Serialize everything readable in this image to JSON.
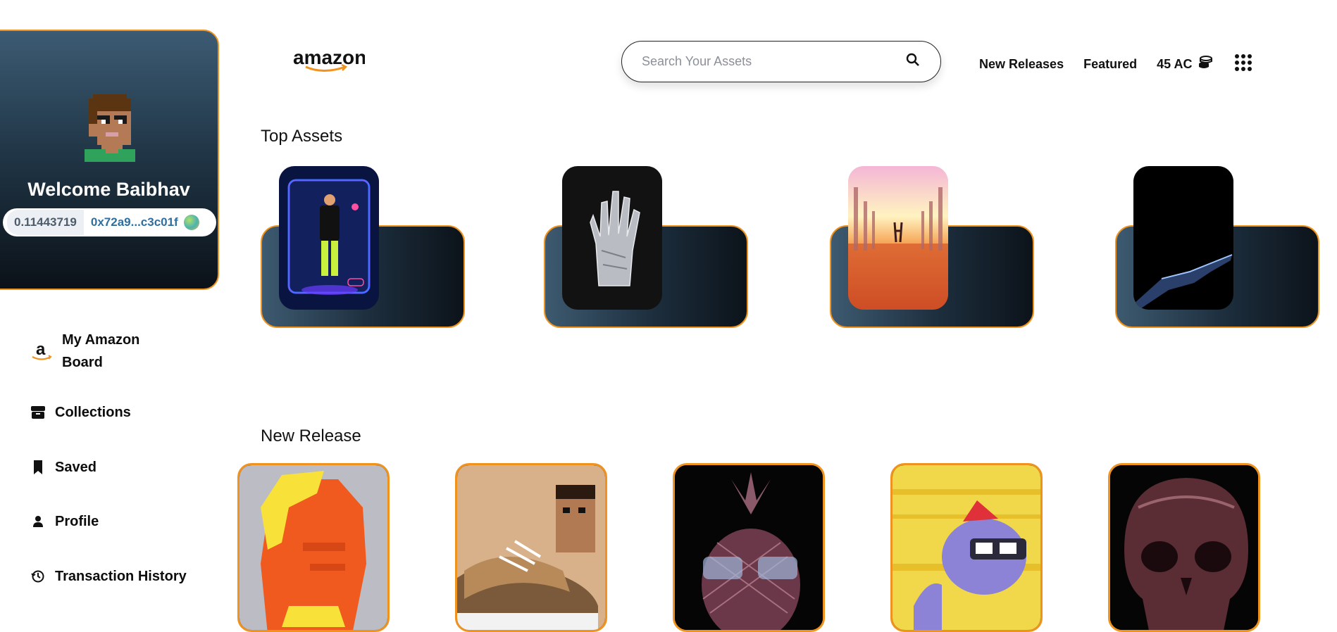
{
  "profile": {
    "welcome": "Welcome Baibhav",
    "balance": "0.11443719",
    "address": "0x72a9...c3c01f"
  },
  "sidebar": {
    "items": [
      {
        "label_line1": "My Amazon",
        "label_line2": "Board",
        "icon": "amazon-a-icon"
      },
      {
        "label": "Collections",
        "icon": "box-icon"
      },
      {
        "label": "Saved",
        "icon": "bookmark-icon"
      },
      {
        "label": "Profile",
        "icon": "user-icon"
      },
      {
        "label": "Transaction History",
        "icon": "history-icon"
      }
    ]
  },
  "header": {
    "logo": "amazon",
    "search_placeholder": "Search Your Assets",
    "links": [
      "New Releases",
      "Featured"
    ],
    "coins": "45 AC"
  },
  "sections": {
    "top_assets": "Top Assets",
    "new_release": "New Release"
  },
  "colors": {
    "accent": "#f0931e",
    "card_dark": "#1c2d3c"
  }
}
